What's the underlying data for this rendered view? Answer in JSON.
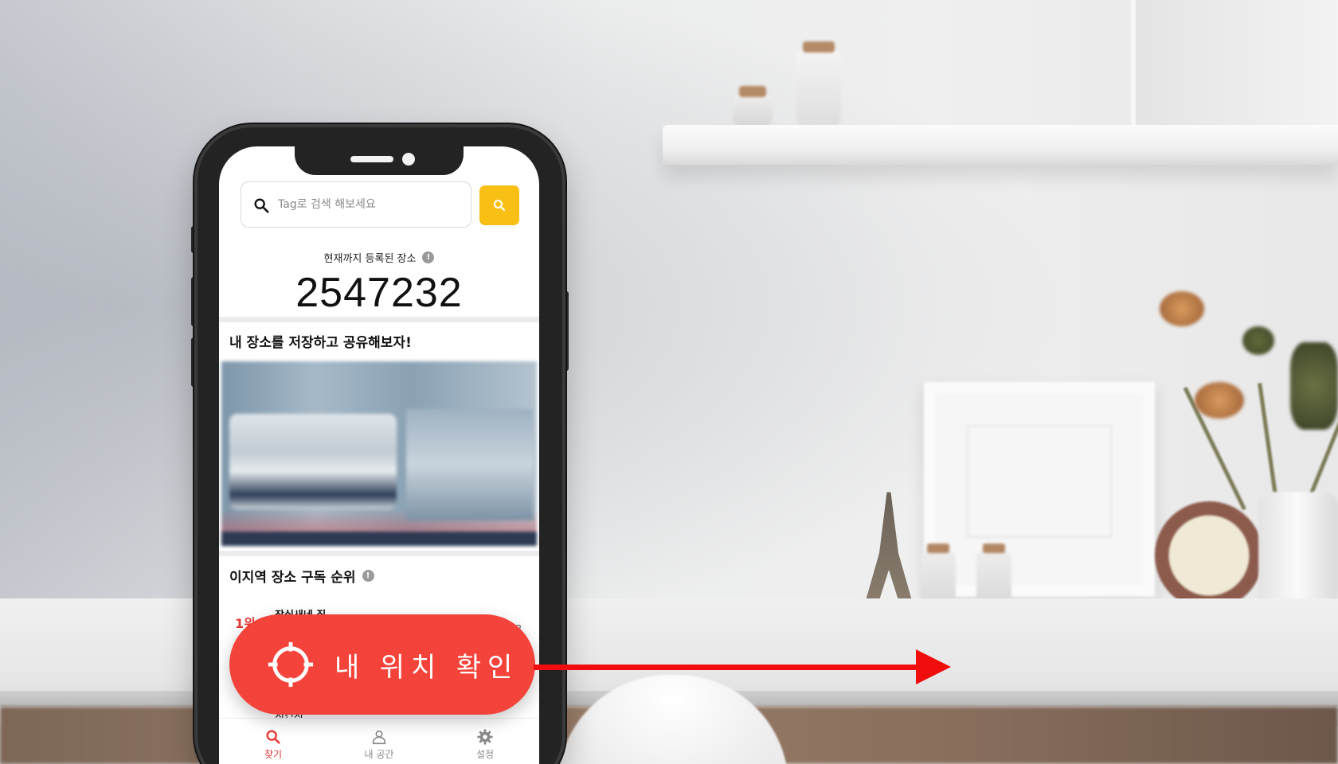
{
  "search": {
    "placeholder": "Tag로 검색 해보세요"
  },
  "stats": {
    "registered_label": "현재까지 등록된 장소",
    "registered_count": "2547232",
    "info_glyph": "!"
  },
  "promo": {
    "title": "내 장소를 저장하고 공유해보자!"
  },
  "ranking": {
    "title": "이지역 장소 구독 순위",
    "info_glyph": "!",
    "items": [
      {
        "rank": "1위",
        "name": "잠실새네 집",
        "count": "3"
      },
      {
        "name": "치킨치"
      }
    ]
  },
  "locate_button": {
    "label": "내 위치 확인"
  },
  "bottom_nav": {
    "items": [
      {
        "label": "찾기",
        "icon": "search-icon",
        "active": true
      },
      {
        "label": "내 공간",
        "icon": "person-icon",
        "active": false
      },
      {
        "label": "설정",
        "icon": "gear-icon",
        "active": false
      }
    ]
  },
  "colors": {
    "accent_red": "#f4433a",
    "search_button_yellow": "#f8c014",
    "arrow_red": "#f20d0d",
    "rank_red": "#e53935"
  }
}
